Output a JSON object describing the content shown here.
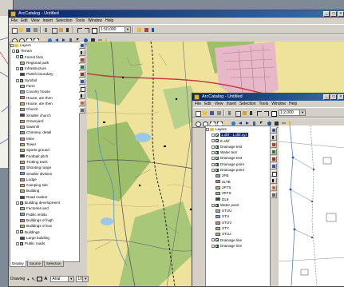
{
  "background_window": {
    "title": "ArcCatalog - Untitled",
    "menu": [
      "File",
      "Edit",
      "View",
      "Insert",
      "Selection",
      "Tools",
      "Window",
      "Help"
    ],
    "scale": "1:50,000",
    "toc_root": "Layers",
    "toc_items": [
      {
        "label": "Terrain",
        "type": "group",
        "level": 0
      },
      {
        "label": "Forest fires",
        "type": "layer",
        "level": 1
      },
      {
        "label": "Regional park",
        "type": "item",
        "level": 2
      },
      {
        "label": "Infrastructure",
        "type": "layer",
        "level": 1
      },
      {
        "label": "Parish boundary",
        "type": "item",
        "level": 2
      },
      {
        "label": "Symbol",
        "type": "layer",
        "level": 1
      },
      {
        "label": "Farm",
        "type": "item",
        "level": 2
      },
      {
        "label": "Country house",
        "type": "item",
        "level": 2
      },
      {
        "label": "House, are then",
        "type": "item",
        "level": 2
      },
      {
        "label": "House, are then",
        "type": "item",
        "level": 2
      },
      {
        "label": "Church",
        "type": "item",
        "level": 2
      },
      {
        "label": "Smaller church",
        "type": "item",
        "level": 2
      },
      {
        "label": "Graveyard",
        "type": "item",
        "level": 2
      },
      {
        "label": "Sawmill",
        "type": "item",
        "level": 2
      },
      {
        "label": "Chimney, detail",
        "type": "item",
        "level": 2
      },
      {
        "label": "Mine",
        "type": "item",
        "level": 2
      },
      {
        "label": "Tower",
        "type": "item",
        "level": 2
      },
      {
        "label": "Sports ground",
        "type": "item",
        "level": 2
      },
      {
        "label": "Football pitch",
        "type": "item",
        "level": 2
      },
      {
        "label": "Trotting track",
        "type": "item",
        "level": 2
      },
      {
        "label": "Shooting range",
        "type": "item",
        "level": 2
      },
      {
        "label": "Smaller division",
        "type": "item",
        "level": 2
      },
      {
        "label": "Lodge",
        "type": "item",
        "level": 2
      },
      {
        "label": "Camping site",
        "type": "item",
        "level": 2
      },
      {
        "label": "Building",
        "type": "item",
        "level": 2
      },
      {
        "label": "Road marker",
        "type": "item",
        "level": 2
      },
      {
        "label": "Building development",
        "type": "layer",
        "level": 1
      },
      {
        "label": "Factories and",
        "type": "item",
        "level": 2
      },
      {
        "label": "Public institu",
        "type": "item",
        "level": 2
      },
      {
        "label": "Buildings of high",
        "type": "item",
        "level": 2
      },
      {
        "label": "Buildings of low",
        "type": "item",
        "level": 2
      },
      {
        "label": "Buildings",
        "type": "layer",
        "level": 1
      },
      {
        "label": "Large building",
        "type": "item",
        "level": 2
      },
      {
        "label": "Public roads",
        "type": "layer",
        "level": 1
      }
    ],
    "tabs": [
      "Display",
      "Source",
      "Selection"
    ],
    "status": {
      "drawing": "Drawing",
      "font": "Arial",
      "size": "10"
    }
  },
  "front_window": {
    "title": "ArcCatalog - Untitled",
    "menu": [
      "File",
      "Edit",
      "View",
      "Insert",
      "Selection",
      "Tools",
      "Window",
      "Help"
    ],
    "scale": "1:2,000",
    "toc_root": "Layers",
    "toc_items": [
      {
        "label": "1.dbf - 1.dbf.xyz",
        "type": "layer",
        "selected": true
      },
      {
        "label": "E.shif",
        "type": "layer"
      },
      {
        "label": "Drainage text",
        "type": "layer"
      },
      {
        "label": "Water text",
        "type": "layer"
      },
      {
        "label": "Drainage text",
        "type": "layer"
      },
      {
        "label": "Drainage point",
        "type": "layer"
      },
      {
        "label": "Drainage point",
        "type": "layer"
      },
      {
        "label": "2FB",
        "type": "item"
      },
      {
        "label": "2LTB",
        "type": "item"
      },
      {
        "label": "2PTS",
        "type": "item"
      },
      {
        "label": "2RTS",
        "type": "item"
      },
      {
        "label": "DL8",
        "type": "item"
      },
      {
        "label": "Water point",
        "type": "layer"
      },
      {
        "label": "STUU",
        "type": "item"
      },
      {
        "label": "STU",
        "type": "item"
      },
      {
        "label": "STUV",
        "type": "item"
      },
      {
        "label": "STY",
        "type": "item"
      },
      {
        "label": "STUJ",
        "type": "item"
      },
      {
        "label": "Drainage line",
        "type": "layer"
      },
      {
        "label": "Drainage line",
        "type": "layer"
      }
    ]
  },
  "colors": {
    "titlebar": "#0a246a",
    "map_yellow": "#efe39c",
    "map_green": "#9dbe6a",
    "map_water": "#cfe3ef",
    "map_pink": "#e6b8c8",
    "window_face": "#d4d0c8"
  }
}
